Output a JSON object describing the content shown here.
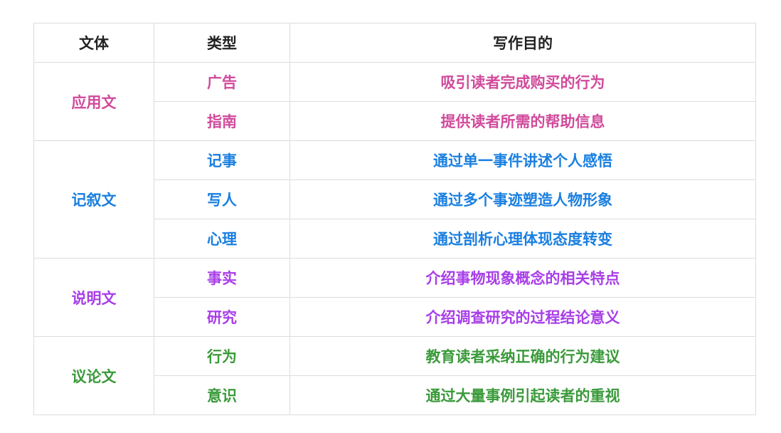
{
  "headers": [
    "文体",
    "类型",
    "写作目的"
  ],
  "groups": [
    {
      "genre": "应用文",
      "color": "#d14a9b",
      "rows": [
        {
          "type": "广告",
          "purpose": "吸引读者完成购买的行为"
        },
        {
          "type": "指南",
          "purpose": "提供读者所需的帮助信息"
        }
      ]
    },
    {
      "genre": "记叙文",
      "color": "#1a7fe0",
      "rows": [
        {
          "type": "记事",
          "purpose": "通过单一事件讲述个人感悟"
        },
        {
          "type": "写人",
          "purpose": "通过多个事迹塑造人物形象"
        },
        {
          "type": "心理",
          "purpose": "通过剖析心理体现态度转变"
        }
      ]
    },
    {
      "genre": "说明文",
      "color": "#a83ee8",
      "rows": [
        {
          "type": "事实",
          "purpose": "介绍事物现象概念的相关特点"
        },
        {
          "type": "研究",
          "purpose": "介绍调查研究的过程结论意义"
        }
      ]
    },
    {
      "genre": "议论文",
      "color": "#3a9a3a",
      "rows": [
        {
          "type": "行为",
          "purpose": "教育读者采纳正确的行为建议"
        },
        {
          "type": "意识",
          "purpose": "通过大量事例引起读者的重视"
        }
      ]
    }
  ]
}
